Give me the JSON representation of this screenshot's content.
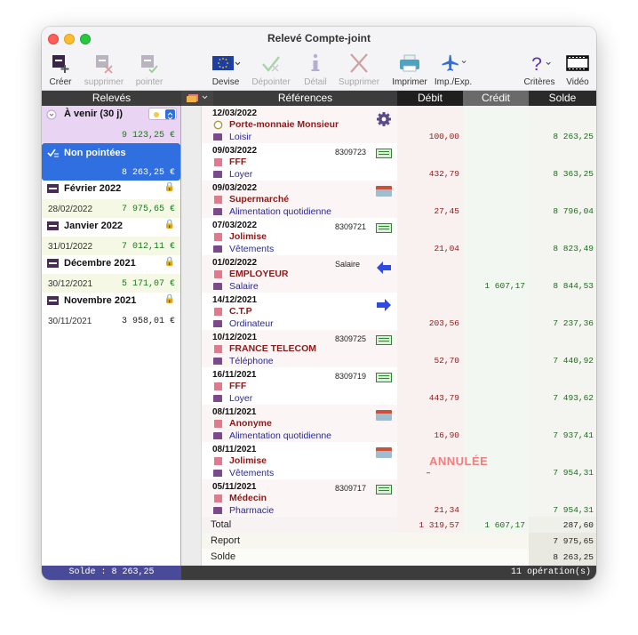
{
  "window": {
    "title": "Relevé Compte-joint"
  },
  "toolbar": {
    "creer": "Créer",
    "supprimer": "supprimer",
    "pointer": "pointer",
    "devise": "Devise",
    "depointer": "Dépointer",
    "detail": "Détail",
    "supprimer2": "Supprimer",
    "imprimer": "Imprimer",
    "impexp": "Imp./Exp.",
    "criteres": "Critères",
    "video": "Vidéo"
  },
  "columns": {
    "releves": "Relevés",
    "references": "Références",
    "debit": "Débit",
    "credit": "Crédit",
    "solde": "Solde"
  },
  "sidebar": {
    "avenir": {
      "label": "À venir (30 j)",
      "amount": "9 123,25 €"
    },
    "nonpointees": {
      "label": "Non pointées",
      "amount": "8 263,25 €"
    },
    "months": [
      {
        "label": "Février 2022",
        "date": "28/02/2022",
        "amount": "7 975,65 €"
      },
      {
        "label": "Janvier 2022",
        "date": "31/01/2022",
        "amount": "7 012,11 €"
      },
      {
        "label": "Décembre 2021",
        "date": "30/12/2021",
        "amount": "5 171,07 €"
      },
      {
        "label": "Novembre 2021",
        "date": "30/11/2021",
        "amount": "3 958,01 €"
      }
    ],
    "footer": "Solde : 8 263,25"
  },
  "transactions": [
    {
      "date": "12/03/2022",
      "num": "",
      "name": "Porte-monnaie Monsieur",
      "cat": "Loisir",
      "debit": "100,00",
      "credit": "",
      "solde": "8 263,25",
      "icon": "gear-icon"
    },
    {
      "date": "09/03/2022",
      "num": "8309723",
      "name": "FFF",
      "cat": "Loyer",
      "debit": "432,79",
      "credit": "",
      "solde": "8 363,25",
      "icon": "cheque-icon"
    },
    {
      "date": "09/03/2022",
      "num": "",
      "name": "Supermarché",
      "cat": "Alimentation quotidienne",
      "debit": "27,45",
      "credit": "",
      "solde": "8 796,04",
      "icon": "card-icon"
    },
    {
      "date": "07/03/2022",
      "num": "8309721",
      "name": "Jolimise",
      "cat": "Vêtements",
      "debit": "21,04",
      "credit": "",
      "solde": "8 823,49",
      "icon": "cheque-icon"
    },
    {
      "date": "01/02/2022",
      "num": "Salaire",
      "name": "EMPLOYEUR",
      "cat": "Salaire",
      "debit": "",
      "credit": "1 607,17",
      "solde": "8 844,53",
      "icon": "arrow-left-icon"
    },
    {
      "date": "14/12/2021",
      "num": "",
      "name": "C.T.P",
      "cat": "Ordinateur",
      "debit": "203,56",
      "credit": "",
      "solde": "7 237,36",
      "icon": "arrow-right-icon"
    },
    {
      "date": "10/12/2021",
      "num": "8309725",
      "name": "FRANCE TELECOM",
      "cat": "Téléphone",
      "debit": "52,70",
      "credit": "",
      "solde": "7 440,92",
      "icon": "cheque-icon"
    },
    {
      "date": "16/11/2021",
      "num": "8309719",
      "name": "FFF",
      "cat": "Loyer",
      "debit": "443,79",
      "credit": "",
      "solde": "7 493,62",
      "icon": "cheque-icon"
    },
    {
      "date": "08/11/2021",
      "num": "",
      "name": "Anonyme",
      "cat": "Alimentation quotidienne",
      "debit": "16,90",
      "credit": "",
      "solde": "7 937,41",
      "icon": "card-icon"
    },
    {
      "date": "08/11/2021",
      "num": "",
      "name": "Jolimise",
      "cat": "Vêtements",
      "debit": "–",
      "credit": "",
      "solde": "7 954,31",
      "icon": "card-icon",
      "annule": "ANNULÉE"
    },
    {
      "date": "05/11/2021",
      "num": "8309717",
      "name": "Médecin",
      "cat": "Pharmacie",
      "debit": "21,34",
      "credit": "",
      "solde": "7 954,31",
      "icon": "cheque-icon"
    }
  ],
  "summary": {
    "total_label": "Total",
    "total_debit": "1 319,57",
    "total_credit": "1 607,17",
    "total_solde": "287,60",
    "report_label": "Report",
    "report_solde": "7 975,65",
    "solde_label": "Solde",
    "solde_solde": "8 263,25"
  },
  "status": {
    "count": "11 opération(s)"
  },
  "colors": {
    "accent": "#2f6fe0",
    "debit": "#8a1a1a",
    "credit": "#1a6a1a",
    "avenir_bg": "#ead4f4"
  }
}
